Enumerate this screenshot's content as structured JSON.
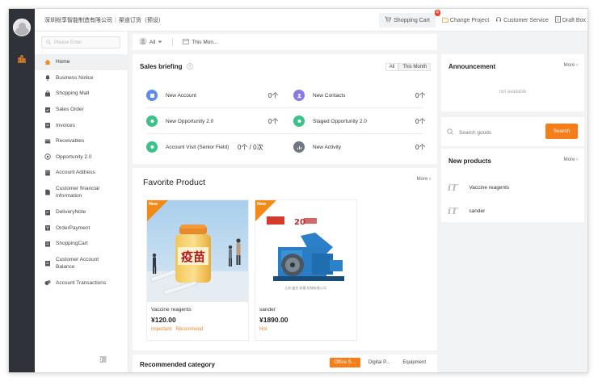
{
  "header": {
    "company": "深圳纷享智能制造有限公司",
    "module": "渠道订货（预设）",
    "cart_label": "Shopping Cart",
    "cart_count": "4",
    "change_project": "Change Project",
    "customer_service": "Customer Service",
    "draft_box": "Draft Box"
  },
  "sidebar": {
    "search_placeholder": "Please Enter",
    "items": [
      {
        "label": "Home",
        "icon": "home-icon"
      },
      {
        "label": "Business Notice",
        "icon": "bell-icon"
      },
      {
        "label": "Shopping Mall",
        "icon": "bag-icon"
      },
      {
        "label": "Sales Order",
        "icon": "clipboard-icon"
      },
      {
        "label": "Invoices",
        "icon": "invoice-icon"
      },
      {
        "label": "Receivables",
        "icon": "receivable-icon"
      },
      {
        "label": "Opportunity 2.0",
        "icon": "target-icon"
      },
      {
        "label": "Account Address",
        "icon": "building-icon"
      },
      {
        "label": "Customer financial information",
        "icon": "document-icon"
      },
      {
        "label": "DeliveryNote",
        "icon": "note-icon"
      },
      {
        "label": "OrderPayment",
        "icon": "payment-icon"
      },
      {
        "label": "ShoppingCart",
        "icon": "cart-icon"
      },
      {
        "label": "Customer Account Balance",
        "icon": "wallet-icon"
      },
      {
        "label": "Account Transactions",
        "icon": "transactions-icon"
      }
    ]
  },
  "filters": {
    "owner": "All",
    "period": "This Mon..."
  },
  "briefing": {
    "title": "Sales briefing",
    "tabs": [
      "All",
      "This Month"
    ],
    "stats": [
      {
        "label": "New Account",
        "value": "0个"
      },
      {
        "label": "New Contacts",
        "value": "0个"
      },
      {
        "label": "New Opportunity 2.0",
        "value": "0个"
      },
      {
        "label": "Staged Opportunity 2.0",
        "value": "0个"
      },
      {
        "label": "Account Visit (Senior Field)",
        "value": "0个 / 0次"
      },
      {
        "label": "New Activity",
        "value": "0个"
      }
    ]
  },
  "announcement": {
    "title": "Announcement",
    "more": "More",
    "empty": "not available"
  },
  "search_goods": {
    "placeholder": "Search goods",
    "button": "Search"
  },
  "new_products": {
    "title": "New products",
    "more": "More",
    "items": [
      {
        "name": "Vaccine reagents",
        "logo": "iT"
      },
      {
        "name": "sander",
        "logo": "iT"
      }
    ]
  },
  "favorite": {
    "title": "Favorite Product",
    "more": "More",
    "products": [
      {
        "tag": "New",
        "name": "Vaccine reagents",
        "price": "¥120.00",
        "labels": [
          "Important",
          "Recommend"
        ],
        "image_text": "疫苗"
      },
      {
        "tag": "New",
        "name": "sander",
        "price": "¥1890.00",
        "labels": [
          "Hot"
        ],
        "image_text": "20"
      }
    ]
  },
  "recommended": {
    "title": "Recommended category",
    "tabs": [
      "Office S...",
      "Digital P...",
      "Equipment"
    ]
  },
  "colors": {
    "accent": "#f57e1b",
    "rail": "#2f3238",
    "stat_blue": "#5b8def",
    "stat_purple": "#8a78e6",
    "stat_green": "#3cc189",
    "stat_gray": "#6f7784"
  }
}
